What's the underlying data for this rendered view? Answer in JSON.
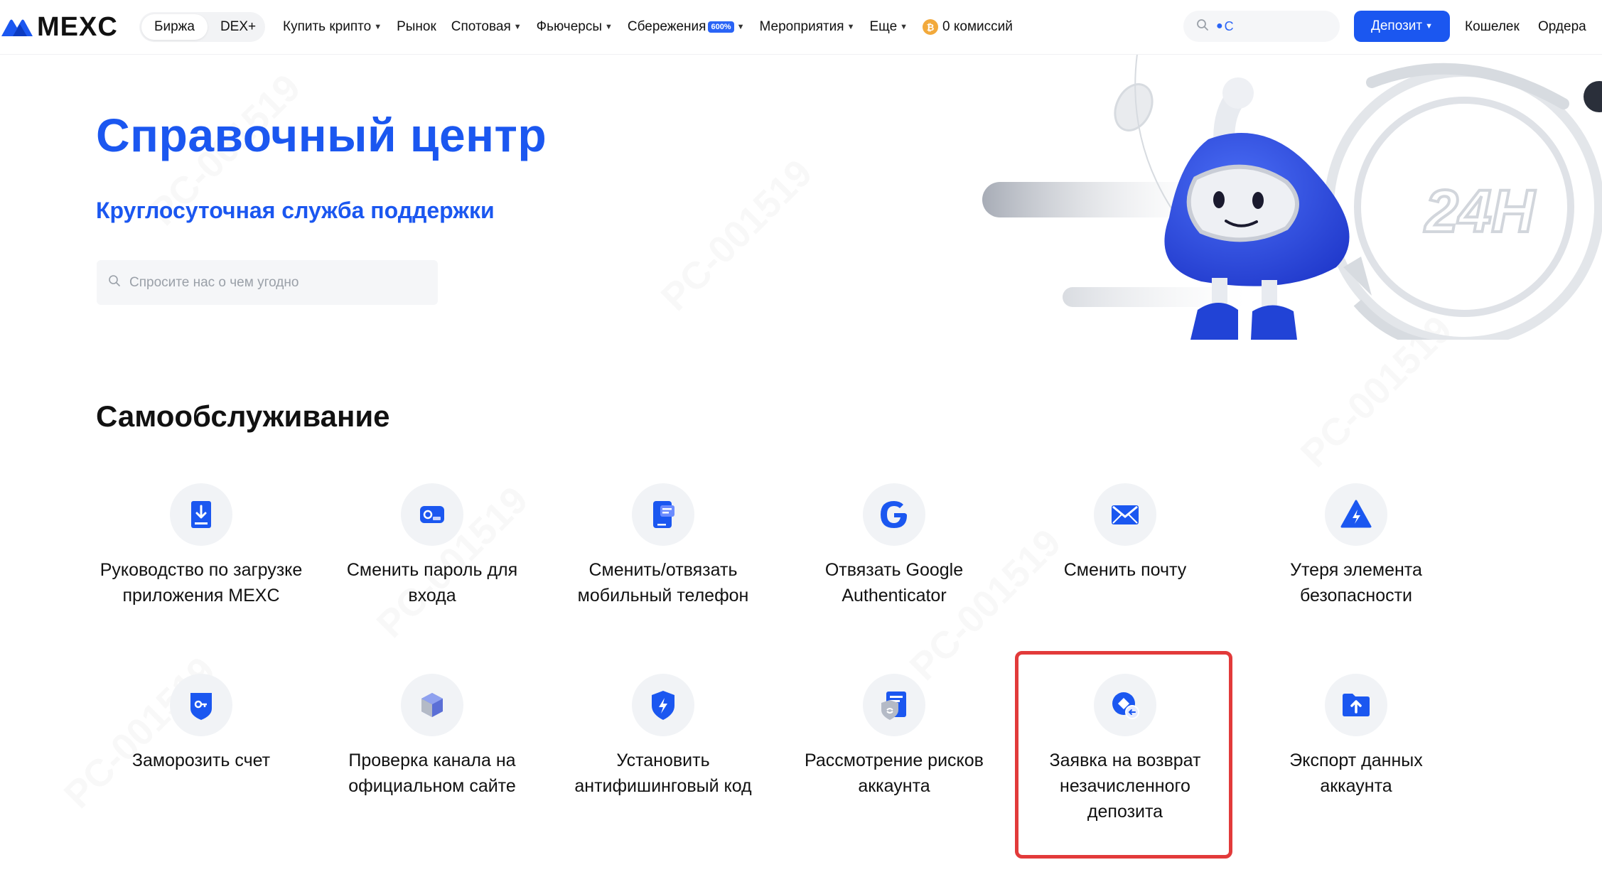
{
  "brand": {
    "logo_text": "MEXC"
  },
  "switch": {
    "exchange": "Биржа",
    "dex": "DEX+"
  },
  "nav": [
    {
      "label": "Купить крипто",
      "caret": true
    },
    {
      "label": "Рынок",
      "caret": false
    },
    {
      "label": "Спотовая",
      "caret": true
    },
    {
      "label": "Фьючерсы",
      "caret": true
    },
    {
      "label": "Сбережения",
      "caret": true,
      "badge": "600%"
    },
    {
      "label": "Мероприятия",
      "caret": true
    },
    {
      "label": "Еще",
      "caret": true
    },
    {
      "label": "0 комиссий",
      "caret": false,
      "icon": "coin-icon"
    }
  ],
  "top_search": {
    "text": "C"
  },
  "buttons": {
    "deposit": "Депозит",
    "wallet": "Кошелек",
    "orders": "Ордера"
  },
  "hero": {
    "title": "Справочный центр",
    "subtitle": "Круглосуточная служба поддержки",
    "search_placeholder": "Спросите нас о чем угодно",
    "art_label": "24H"
  },
  "self_service": {
    "title": "Самообслуживание",
    "tiles": [
      {
        "label": "Руководство по загрузке приложения MEXC",
        "icon": "download-icon"
      },
      {
        "label": "Сменить пароль для входа",
        "icon": "password-icon"
      },
      {
        "label": "Сменить/отвязать мобильный телефон",
        "icon": "phone-icon"
      },
      {
        "label": "Отвязать Google Authenticator",
        "icon": "google-icon"
      },
      {
        "label": "Сменить почту",
        "icon": "mail-icon"
      },
      {
        "label": "Утеря элемента безопасности",
        "icon": "warning-icon"
      },
      {
        "label": "Заморозить счет",
        "icon": "freeze-icon"
      },
      {
        "label": "Проверка канала на официальном сайте",
        "icon": "cube-icon"
      },
      {
        "label": "Установить антифишинговый код",
        "icon": "shield-icon"
      },
      {
        "label": "Рассмотрение рисков аккаунта",
        "icon": "risk-review-icon"
      },
      {
        "label": "Заявка на возврат незачисленного депозита",
        "icon": "refund-icon",
        "highlighted": true
      },
      {
        "label": "Экспорт данных аккаунта",
        "icon": "export-icon"
      }
    ]
  },
  "colors": {
    "brand_blue": "#1b57f0",
    "highlight_red": "#e23a3a",
    "icon_bg": "#f1f3f6"
  }
}
